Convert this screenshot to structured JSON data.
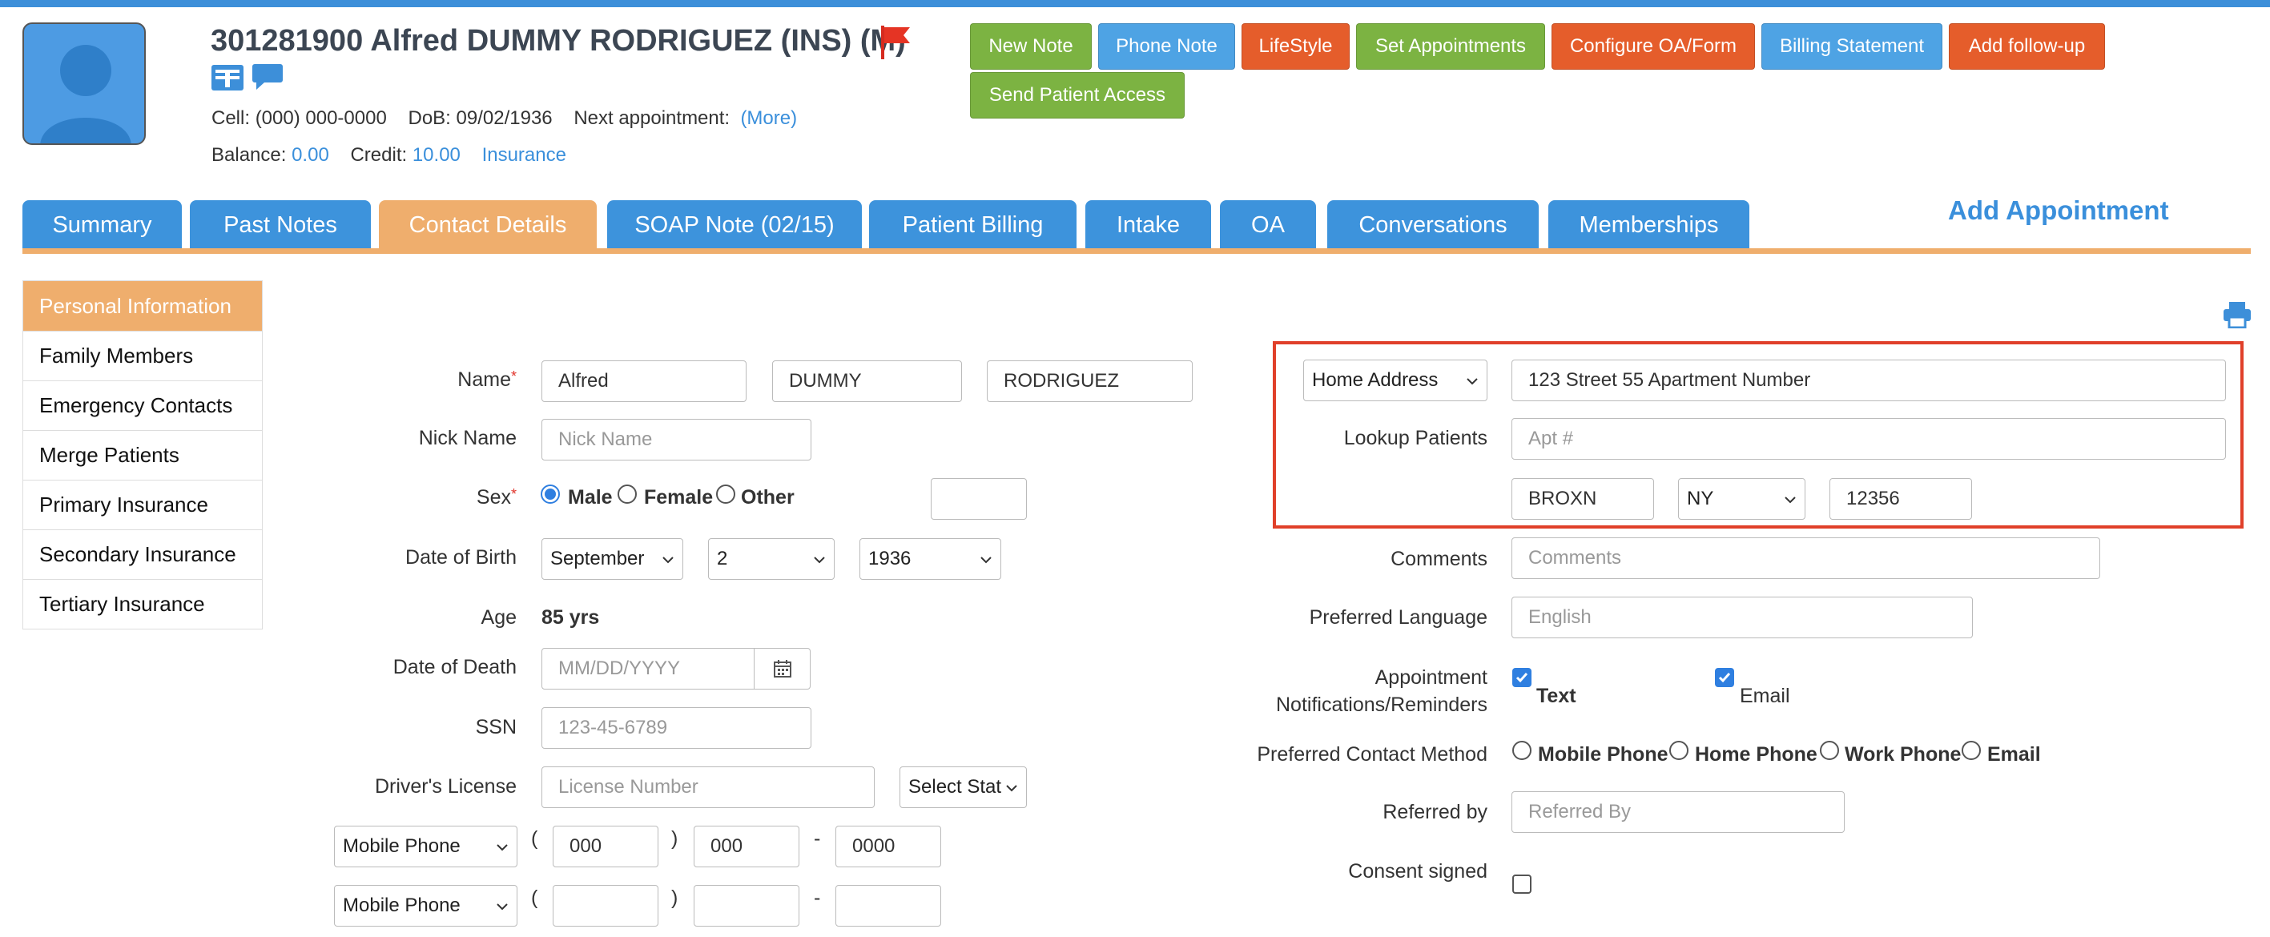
{
  "header": {
    "patient_title": "301281900 Alfred DUMMY RODRIGUEZ  (INS) (M)",
    "cell_label": "Cell:",
    "cell_value": "(000) 000-0000",
    "dob_label": "DoB:",
    "dob_value": "09/02/1936",
    "next_appt_label": "Next appointment:",
    "more_link": "(More)",
    "balance_label": "Balance:",
    "balance_value": "0.00",
    "credit_label": "Credit:",
    "credit_value": "10.00",
    "insurance_link": "Insurance"
  },
  "actions": {
    "new_note": "New Note",
    "phone_note": "Phone Note",
    "lifestyle": "LifeStyle",
    "set_appointments": "Set Appointments",
    "configure_oa": "Configure OA/Form",
    "billing_statement": "Billing Statement",
    "add_followup": "Add follow-up",
    "send_patient_access": "Send Patient Access"
  },
  "tabs": [
    {
      "label": "Summary"
    },
    {
      "label": "Past Notes"
    },
    {
      "label": "Contact Details"
    },
    {
      "label": "SOAP Note (02/15)"
    },
    {
      "label": "Patient Billing"
    },
    {
      "label": "Intake"
    },
    {
      "label": "OA"
    },
    {
      "label": "Conversations"
    },
    {
      "label": "Memberships"
    }
  ],
  "active_tab": "Contact Details",
  "add_appointment": "Add Appointment",
  "sidebar": {
    "items": [
      {
        "label": "Personal Information"
      },
      {
        "label": "Family Members"
      },
      {
        "label": "Emergency Contacts"
      },
      {
        "label": "Merge Patients"
      },
      {
        "label": "Primary Insurance"
      },
      {
        "label": "Secondary Insurance"
      },
      {
        "label": "Tertiary Insurance"
      }
    ]
  },
  "form": {
    "name_label": "Name",
    "first_name": "Alfred",
    "middle_name": "DUMMY",
    "last_name": "RODRIGUEZ",
    "nick_name_label": "Nick Name",
    "nick_name_placeholder": "Nick Name",
    "sex_label": "Sex",
    "sex_options": [
      "Male",
      "Female",
      "Other"
    ],
    "sex_selected": "Male",
    "dob_label": "Date of Birth",
    "dob_month": "September",
    "dob_day": "2",
    "dob_year": "1936",
    "age_label": "Age",
    "age_value": "85 yrs",
    "dod_label": "Date of Death",
    "dod_placeholder": "MM/DD/YYYY",
    "ssn_label": "SSN",
    "ssn_placeholder": "123-45-6789",
    "license_label": "Driver's License",
    "license_placeholder": "License Number",
    "license_state": "Select Stat",
    "phone1_type": "Mobile Phone",
    "phone1_area": "000",
    "phone1_prefix": "000",
    "phone1_line": "0000",
    "phone2_type": "Mobile Phone",
    "paren_open": "(",
    "paren_close": ")",
    "dash": "-"
  },
  "address": {
    "type": "Home Address",
    "street": "123 Street 55 Apartment Number",
    "lookup_link": "Lookup Patients",
    "apt_placeholder": "Apt #",
    "city": "BROXN",
    "state": "NY",
    "zip": "12356"
  },
  "right_form": {
    "comments_label": "Comments",
    "comments_placeholder": "Comments",
    "language_label": "Preferred Language",
    "language_placeholder": "English",
    "notif_label_1": "Appointment",
    "notif_label_2": "Notifications/Reminders",
    "notif_text": "Text",
    "notif_email": "Email",
    "contact_method_label": "Preferred Contact Method",
    "contact_methods": [
      "Mobile Phone",
      "Home Phone",
      "Work Phone",
      "Email"
    ],
    "referred_label": "Referred by",
    "referred_placeholder": "Referred By",
    "consent_label": "Consent signed"
  },
  "colors": {
    "primary_blue": "#3d93dc",
    "active_orange": "#efae6d",
    "action_green": "#7cb342",
    "action_orange": "#e55d2b",
    "highlight_red": "#e0402a"
  }
}
